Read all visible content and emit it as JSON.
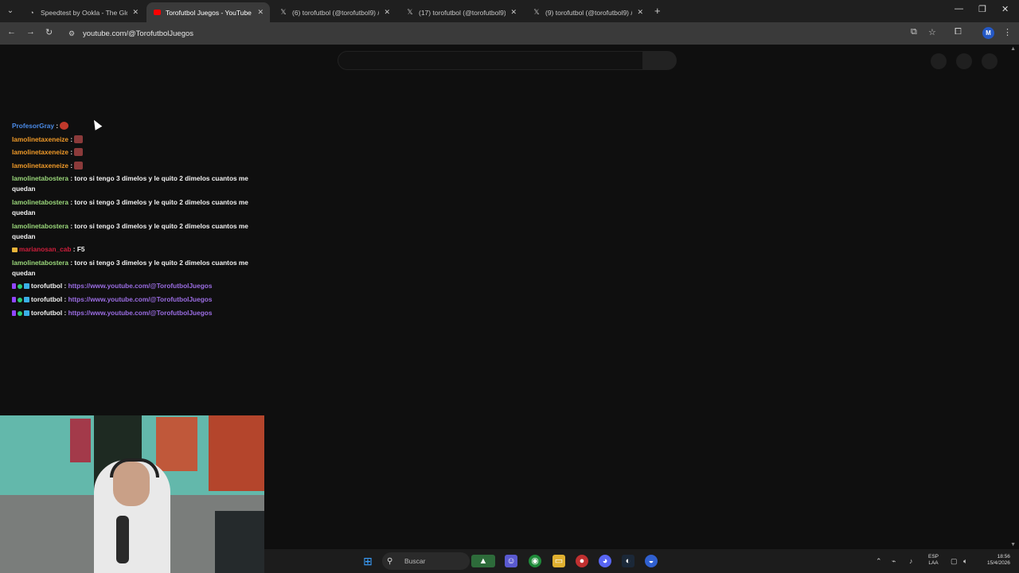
{
  "browser": {
    "tabs": [
      {
        "title": "Speedtest by Ookla - The Glob",
        "icon": "speedtest-icon",
        "active": false
      },
      {
        "title": "Torofutbol Juegos - YouTube",
        "icon": "youtube-icon",
        "active": true
      },
      {
        "title": "(6) torofutbol (@torofutbol9) /",
        "icon": "x-icon",
        "active": false
      },
      {
        "title": "(17) torofutbol (@torofutbol9) /",
        "icon": "x-icon",
        "active": false
      },
      {
        "title": "(9) torofutbol (@torofutbol9) /",
        "icon": "x-icon",
        "active": false
      }
    ],
    "url": "youtube.com/@TorofutbolJuegos",
    "profile_initial": "M"
  },
  "chat": {
    "messages": [
      {
        "user": "ProfesorGray",
        "sep": " :",
        "text": "",
        "user_color": "blue",
        "emote": true
      },
      {
        "user": "lamolinetaxeneize",
        "sep": " :",
        "text": "",
        "user_color": "orange",
        "emote": true
      },
      {
        "user": "lamolinetaxeneize",
        "sep": " :",
        "text": "",
        "user_color": "orange",
        "emote": true
      },
      {
        "user": "lamolinetaxeneize",
        "sep": " :",
        "text": "",
        "user_color": "orange",
        "emote": true
      },
      {
        "user": "lamolinetabostera",
        "sep": " :",
        "text": " toro si tengo 3 dimelos y le quito 2 dimelos cuantos me quedan",
        "user_color": "green"
      },
      {
        "user": "lamolinetabostera",
        "sep": " :",
        "text": " toro si tengo 3 dimelos y le quito 2 dimelos cuantos me quedan",
        "user_color": "green"
      },
      {
        "user": "lamolinetabostera",
        "sep": " :",
        "text": " toro si tengo 3 dimelos y le quito 2 dimelos cuantos me quedan",
        "user_color": "green"
      },
      {
        "user": "marianosan_cab",
        "sep": " :",
        "text": " F5",
        "user_color": "red"
      },
      {
        "user": "lamolinetabostera",
        "sep": " :",
        "text": " toro si tengo 3 dimelos y le quito 2 dimelos cuantos me quedan",
        "user_color": "green"
      },
      {
        "user": "torofutbol",
        "sep": " :",
        "text": "",
        "link": "https://www.youtube.com/@TorofutbolJuegos",
        "user_color": "white"
      },
      {
        "user": "torofutbol",
        "sep": " :",
        "text": "",
        "link": "https://www.youtube.com/@TorofutbolJuegos",
        "user_color": "white"
      },
      {
        "user": "torofutbol",
        "sep": " :",
        "text": "",
        "link": "https://www.youtube.com/@TorofutbolJuegos",
        "user_color": "white"
      }
    ]
  },
  "taskbar": {
    "search_label": "Buscar",
    "lang_top": "ESP",
    "lang_bottom": "LAA",
    "time": "18:56",
    "date": "15/4/2026"
  },
  "colors": {
    "blue_user": "#4a8ae6",
    "orange_user": "#f09a28",
    "green_user": "#9ad77a",
    "red_user": "#d01e3c",
    "link": "#9b6de3"
  }
}
